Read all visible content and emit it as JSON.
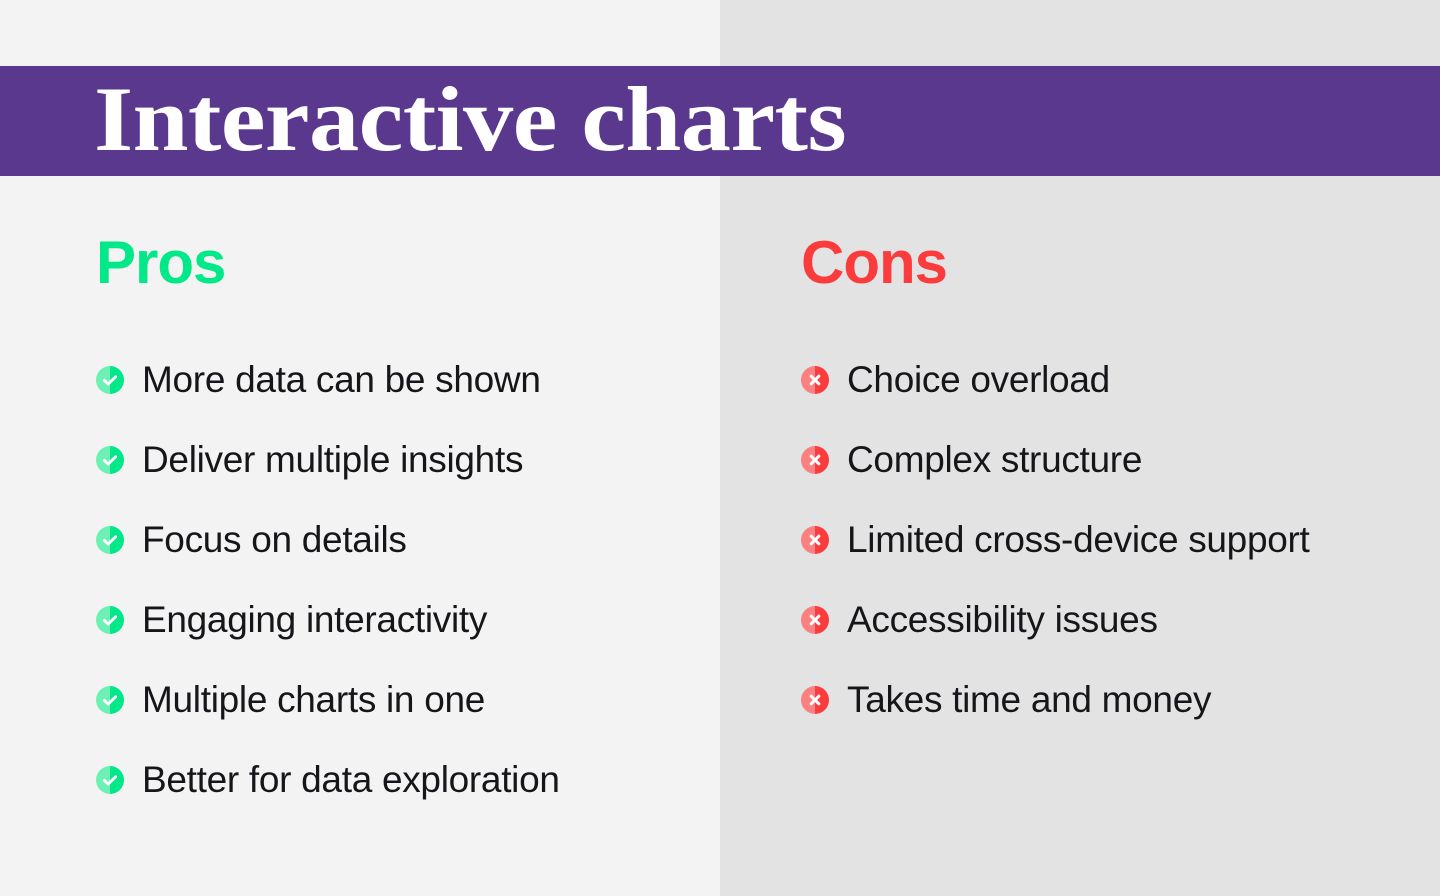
{
  "background": {
    "left_color": "#f3f3f3",
    "right_color": "#e3e3e3"
  },
  "banner": {
    "title": "Interactive charts",
    "background_color": "#59388d",
    "text_color": "#ffffff"
  },
  "pros": {
    "heading": "Pros",
    "heading_color": "#00e887",
    "icon_name": "check-circle-icon",
    "icon_color": "#00e887",
    "icon_color_light": "#6ef0b4",
    "items": [
      "More data can be shown",
      "Deliver multiple insights",
      "Focus on details",
      "Engaging interactivity",
      "Multiple charts in one",
      "Better for data exploration"
    ]
  },
  "cons": {
    "heading": "Cons",
    "heading_color": "#fa3c3c",
    "icon_name": "cross-circle-icon",
    "icon_color": "#fa3c3c",
    "icon_color_light": "#fb8080",
    "items": [
      "Choice overload",
      "Complex structure",
      "Limited cross-device support",
      "Accessibility issues",
      "Takes time and money"
    ]
  }
}
